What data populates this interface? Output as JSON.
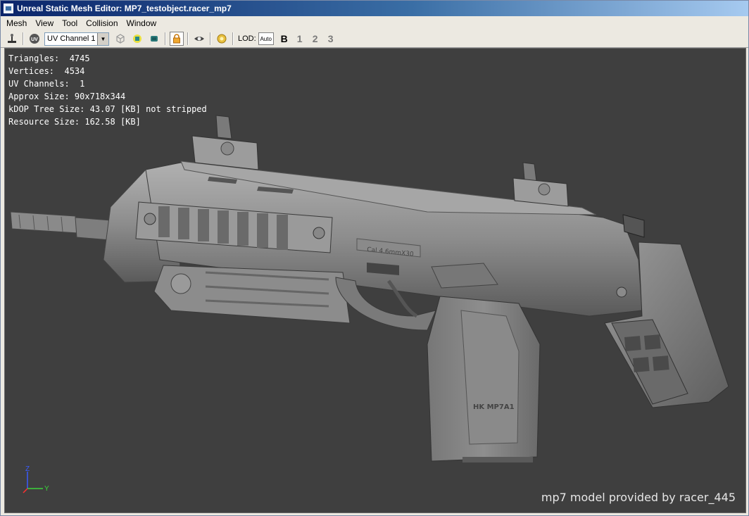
{
  "window": {
    "title": "Unreal Static Mesh Editor: MP7_testobject.racer_mp7"
  },
  "menu": [
    "Mesh",
    "View",
    "Tool",
    "Collision",
    "Window"
  ],
  "toolbar": {
    "uv_channel_value": "UV Channel 1",
    "lod_label": "LOD:",
    "lod_auto": "Auto",
    "lod_levels": [
      "B",
      "1",
      "2",
      "3"
    ],
    "icons": [
      "pivot-icon",
      "uv-icon",
      "wireframe-cube-icon",
      "collision-icon",
      "normals-icon",
      "lock-icon",
      "eye-icon",
      "sun-icon"
    ]
  },
  "stats": {
    "triangles": "Triangles:  4745",
    "vertices": "Vertices:  4534",
    "uv_channels": "UV Channels:  1",
    "approx_size": "Approx Size: 90x718x344",
    "kdop": "kDOP Tree Size: 43.07 [KB] not stripped",
    "resource_size": "Resource Size: 162.58 [KB]"
  },
  "viewport": {
    "background": "#3f3f3f",
    "mesh_color": "#8c8c8c",
    "credit": "mp7 model provided by racer_445",
    "stock_label": "Cal 4.6mmX30",
    "grip_logo": "HK MP7A1"
  },
  "axis": {
    "z": "Z",
    "y": "Y",
    "z_color": "#3a5cff",
    "y_color": "#3bd43b",
    "x_color": "#ff3030"
  }
}
